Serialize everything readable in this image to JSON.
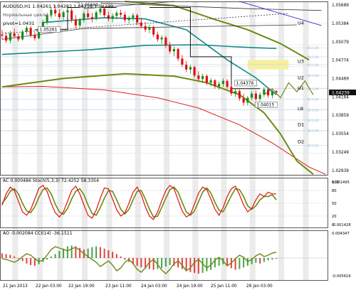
{
  "header": {
    "symbol_line": "AUDUSD,H1  1.04261 1.04282 1.04219 1.04239",
    "subtitle": "Нормальные циклы...",
    "pivot_line": "pivot=1.0431"
  },
  "colors": {
    "background": "#ffffff",
    "bull": "#1a8a1a",
    "bear": "#e01010",
    "teal_ma": "#118888",
    "olive_ma": "#6b8a10",
    "red_ma": "#e02020",
    "blue_line": "#4444dd",
    "pivot_zone": "#f5f0a0",
    "grid_band": "#e4e4e4"
  },
  "chart_data": [
    {
      "type": "candlestick",
      "panel": "price",
      "title": "AUDUSD,H1",
      "ohlc_last": {
        "open": 1.04261,
        "high": 1.04282,
        "low": 1.04219,
        "close": 1.04239
      },
      "ylim": [
        1.0287,
        1.0575
      ],
      "y_ticks": [
        "1.05689",
        "1.05384",
        "1.05079",
        "1.04774",
        "1.04469",
        "1.04164",
        "1.03859",
        "1.03554",
        "1.03249",
        "1.02939"
      ],
      "current_price_label": "1.04239",
      "candles": [
        [
          1.052,
          1.0528,
          1.0512,
          1.0518
        ],
        [
          1.0518,
          1.0524,
          1.0506,
          1.051
        ],
        [
          1.051,
          1.0526,
          1.0505,
          1.0522
        ],
        [
          1.0522,
          1.053,
          1.0515,
          1.0517
        ],
        [
          1.0517,
          1.0522,
          1.0508,
          1.0512
        ],
        [
          1.0512,
          1.0528,
          1.051,
          1.0525
        ],
        [
          1.0525,
          1.0535,
          1.052,
          1.0531
        ],
        [
          1.0531,
          1.0534,
          1.0515,
          1.0519
        ],
        [
          1.0519,
          1.0524,
          1.051,
          1.0514
        ],
        [
          1.0514,
          1.053,
          1.0512,
          1.0527
        ],
        [
          1.0527,
          1.0545,
          1.0525,
          1.0541
        ],
        [
          1.0541,
          1.0556,
          1.0536,
          1.0552
        ],
        [
          1.0552,
          1.0566,
          1.0547,
          1.0561
        ],
        [
          1.0561,
          1.0569,
          1.055,
          1.0555
        ],
        [
          1.0555,
          1.0562,
          1.0545,
          1.0549
        ],
        [
          1.0549,
          1.056,
          1.0544,
          1.0557
        ],
        [
          1.0557,
          1.0566,
          1.0552,
          1.056
        ],
        [
          1.056,
          1.0564,
          1.054,
          1.0545
        ],
        [
          1.0545,
          1.0552,
          1.053,
          1.0535
        ],
        [
          1.0535,
          1.0548,
          1.0531,
          1.0544
        ],
        [
          1.0544,
          1.0559,
          1.054,
          1.0555
        ],
        [
          1.0555,
          1.0562,
          1.0545,
          1.0549
        ],
        [
          1.0549,
          1.0556,
          1.054,
          1.0546
        ],
        [
          1.0546,
          1.056,
          1.0543,
          1.0557
        ],
        [
          1.0557,
          1.0567,
          1.0552,
          1.0563
        ],
        [
          1.0563,
          1.0566,
          1.0548,
          1.0552
        ],
        [
          1.0552,
          1.0558,
          1.0542,
          1.0546
        ],
        [
          1.0546,
          1.0555,
          1.054,
          1.0551
        ],
        [
          1.0551,
          1.056,
          1.0545,
          1.0556
        ],
        [
          1.0556,
          1.0561,
          1.0549,
          1.0553
        ],
        [
          1.0553,
          1.0558,
          1.054,
          1.0544
        ],
        [
          1.0544,
          1.0551,
          1.0538,
          1.0548
        ],
        [
          1.0548,
          1.0556,
          1.0542,
          1.0552
        ],
        [
          1.0552,
          1.0555,
          1.0536,
          1.054
        ],
        [
          1.054,
          1.0548,
          1.053,
          1.0534
        ],
        [
          1.0534,
          1.0541,
          1.0524,
          1.0528
        ],
        [
          1.0528,
          1.0536,
          1.0522,
          1.0532
        ],
        [
          1.0532,
          1.0535,
          1.0516,
          1.052
        ],
        [
          1.052,
          1.0525,
          1.0508,
          1.0512
        ],
        [
          1.0512,
          1.0519,
          1.0504,
          1.0515
        ],
        [
          1.0515,
          1.0518,
          1.0498,
          1.0502
        ],
        [
          1.0502,
          1.0508,
          1.0488,
          1.0492
        ],
        [
          1.0492,
          1.05,
          1.0484,
          1.0496
        ],
        [
          1.0496,
          1.0498,
          1.0476,
          1.048
        ],
        [
          1.048,
          1.0486,
          1.0466,
          1.047
        ],
        [
          1.047,
          1.0476,
          1.0458,
          1.0462
        ],
        [
          1.0462,
          1.047,
          1.0455,
          1.0466
        ],
        [
          1.0466,
          1.0468,
          1.0448,
          1.0452
        ],
        [
          1.0452,
          1.0459,
          1.0442,
          1.0446
        ],
        [
          1.0446,
          1.0455,
          1.044,
          1.0451
        ],
        [
          1.0451,
          1.0454,
          1.0436,
          1.044
        ],
        [
          1.044,
          1.0448,
          1.0434,
          1.0444
        ],
        [
          1.0444,
          1.0446,
          1.043,
          1.0434
        ],
        [
          1.0434,
          1.0442,
          1.0428,
          1.0438
        ],
        [
          1.0438,
          1.0447,
          1.0433,
          1.0443
        ],
        [
          1.0443,
          1.0446,
          1.043,
          1.0433
        ],
        [
          1.0433,
          1.0437,
          1.0418,
          1.0422
        ],
        [
          1.0422,
          1.043,
          1.0416,
          1.0426
        ],
        [
          1.0426,
          1.0429,
          1.041,
          1.0414
        ],
        [
          1.0414,
          1.0422,
          1.0402,
          1.0407
        ],
        [
          1.0407,
          1.0418,
          1.0402,
          1.0415
        ],
        [
          1.0415,
          1.0426,
          1.0411,
          1.0422
        ],
        [
          1.0422,
          1.0427,
          1.041,
          1.0413
        ],
        [
          1.0413,
          1.0424,
          1.0409,
          1.042
        ],
        [
          1.042,
          1.0433,
          1.0416,
          1.0429
        ],
        [
          1.0429,
          1.0431,
          1.0415,
          1.0419
        ],
        [
          1.0419,
          1.0428,
          1.0414,
          1.0426
        ],
        [
          1.0426,
          1.0428,
          1.0422,
          1.0424
        ]
      ],
      "price_labels": [
        "1.05669",
        "1.05261",
        "1.04376",
        "1.04015"
      ],
      "pivot_levels": [
        "U4",
        "U3",
        "U2",
        "U1",
        "LB",
        "D1",
        "D2"
      ],
      "pivot_values": [
        1.0539,
        1.0475,
        1.0448,
        1.0431,
        1.0397,
        1.037,
        1.0342
      ],
      "faint_labels": [
        "R5 1.05",
        "R4 1.04",
        "R3 1.04",
        "R2 1.04",
        "R1 1.04",
        "S1 1.04",
        "S2 1.03",
        "S3 1.03",
        "S4 1.03",
        "S5 1.03"
      ],
      "faint_values": [
        1.0498,
        1.0483,
        1.047,
        1.0452,
        1.043,
        1.0413,
        1.0395,
        1.0378,
        1.0361,
        1.0336
      ],
      "pivot_zone": [
        1.0462,
        1.0478
      ],
      "teal_ma": [
        [
          0,
          1.0487
        ],
        [
          22,
          1.0495
        ],
        [
          35,
          1.0502
        ],
        [
          48,
          1.0503
        ],
        [
          56,
          1.05
        ],
        [
          62,
          1.0498
        ],
        [
          67,
          1.0497
        ]
      ],
      "teal_ma2": [
        [
          10,
          1.054
        ],
        [
          25,
          1.0548
        ],
        [
          35,
          1.0546
        ],
        [
          45,
          1.0528
        ],
        [
          55,
          1.0478
        ],
        [
          62,
          1.0448
        ],
        [
          67,
          1.042
        ]
      ],
      "olive_ma": [
        [
          0,
          1.0433
        ],
        [
          15,
          1.0447
        ],
        [
          30,
          1.0455
        ],
        [
          42,
          1.0451
        ],
        [
          50,
          1.044
        ],
        [
          58,
          1.042
        ],
        [
          64,
          1.039
        ],
        [
          68,
          1.0355
        ],
        [
          72,
          1.031
        ],
        [
          76,
          1.0288
        ]
      ],
      "olive_ma2": [
        [
          30,
          1.0575
        ],
        [
          42,
          1.0568
        ],
        [
          52,
          1.0545
        ],
        [
          60,
          1.0528
        ],
        [
          68,
          1.0505
        ],
        [
          75,
          1.0478
        ]
      ],
      "red_ma": [
        [
          0,
          1.0433
        ],
        [
          10,
          1.0434
        ],
        [
          25,
          1.0428
        ],
        [
          38,
          1.0415
        ],
        [
          48,
          1.0398
        ],
        [
          58,
          1.037
        ],
        [
          66,
          1.034
        ],
        [
          75,
          1.03
        ],
        [
          79,
          1.0288
        ]
      ],
      "projection": [
        [
          64,
          1.042
        ],
        [
          66,
          1.043
        ],
        [
          68,
          1.0415
        ],
        [
          70,
          1.044
        ],
        [
          72,
          1.0425
        ],
        [
          74,
          1.0443
        ],
        [
          76,
          1.042
        ]
      ],
      "dark_lines": [
        [
          [
            0,
            1.0522
          ],
          [
            70,
            1.0555
          ]
        ],
        [
          [
            0,
            1.0512
          ],
          [
            20,
            1.053
          ],
          [
            72,
            1.0536
          ]
        ],
        [
          [
            20,
            1.0563
          ],
          [
            42,
            1.0575
          ]
        ],
        [
          [
            14,
            1.0575
          ],
          [
            60,
            1.0563
          ],
          [
            78,
            1.056
          ]
        ]
      ],
      "blue_line": [
        [
          58,
          1.0575
        ],
        [
          78,
          1.0535
        ]
      ],
      "boxes": [
        [
          [
            8,
            1.0528
          ],
          [
            16,
            1.0528
          ],
          [
            16,
            1.0565
          ],
          [
            28,
            1.0565
          ]
        ],
        [
          [
            36,
            1.0565
          ],
          [
            46,
            1.0565
          ],
          [
            46,
            1.0483
          ],
          [
            56,
            1.0483
          ],
          [
            56,
            1.043
          ],
          [
            63,
            1.043
          ]
        ]
      ],
      "vertical_bands": [
        3,
        9,
        14,
        20,
        26,
        33,
        40,
        47,
        54,
        61,
        68,
        74
      ]
    },
    {
      "type": "line",
      "panel": "ac_stoch",
      "header": "AC 0.000486  Stoch(5,3,3) 72.4252 58.3354",
      "right_labels": [
        "0.001495",
        "100",
        "80",
        "50",
        "20",
        "0",
        "-0.001428"
      ],
      "stoch_main": [
        45,
        72,
        88,
        80,
        55,
        30,
        22,
        35,
        60,
        85,
        92,
        78,
        50,
        28,
        18,
        30,
        55,
        80,
        90,
        72,
        46,
        22,
        15,
        34,
        62,
        86,
        84,
        60,
        35,
        20,
        28,
        50,
        76,
        88,
        70,
        42,
        20,
        12,
        30,
        56,
        80,
        92,
        84,
        58,
        32,
        18,
        24,
        48,
        74,
        88,
        82,
        60,
        36,
        22,
        40,
        66,
        84,
        90,
        70,
        46,
        30,
        38,
        58,
        72,
        66,
        76,
        72,
        72
      ],
      "stoch_signal": [
        50,
        62,
        78,
        84,
        72,
        50,
        32,
        28,
        42,
        64,
        82,
        86,
        72,
        48,
        30,
        24,
        38,
        60,
        78,
        84,
        70,
        46,
        26,
        22,
        40,
        62,
        80,
        78,
        58,
        36,
        25,
        36,
        58,
        78,
        80,
        60,
        36,
        18,
        20,
        40,
        62,
        82,
        88,
        76,
        52,
        30,
        22,
        32,
        54,
        76,
        86,
        74,
        52,
        34,
        30,
        48,
        68,
        84,
        82,
        66,
        44,
        36,
        44,
        58,
        66,
        66,
        70,
        58
      ]
    },
    {
      "type": "bar",
      "panel": "ao_cci",
      "header": "AO -0.002084  CCI(14) -36.1511",
      "right_labels": [
        "0.004347",
        "-0.005616"
      ],
      "ao": [
        12,
        10,
        8,
        4,
        -2,
        -8,
        -14,
        -18,
        -20,
        -16,
        -10,
        -4,
        4,
        10,
        18,
        24,
        30,
        32,
        30,
        26,
        22,
        24,
        28,
        30,
        28,
        24,
        20,
        16,
        10,
        4,
        -4,
        -10,
        -16,
        -20,
        -24,
        -26,
        -28,
        -30,
        -28,
        -26,
        -22,
        -18,
        -20,
        -24,
        -28,
        -32,
        -36,
        -38,
        -40,
        -38,
        -34,
        -30,
        -24,
        -20,
        -16,
        -20,
        -26,
        -30,
        -28,
        -24,
        -20,
        -16,
        -12,
        -14,
        -10,
        -6,
        -4,
        -2
      ],
      "cci": [
        -10,
        -20,
        -40,
        -60,
        -30,
        20,
        60,
        40,
        -10,
        -50,
        -30,
        40,
        120,
        160,
        140,
        120,
        100,
        130,
        150,
        110,
        60,
        20,
        -20,
        -60,
        -120,
        -80,
        -40,
        -100,
        -180,
        -140,
        -60,
        -20,
        -80,
        -160,
        -200,
        -140,
        -60,
        -20,
        -90,
        -170,
        -220,
        -160,
        -80,
        -40,
        -100,
        -180,
        -140,
        -60,
        -20,
        -80,
        -140,
        -100,
        -30,
        10,
        -40,
        -110,
        -70,
        -10,
        40,
        10,
        -50,
        -20,
        30,
        60,
        20,
        40,
        70,
        80
      ]
    },
    {
      "type": "axis",
      "panel": "time",
      "x_tick_labels": [
        "21 Jan 2013",
        "22 Jan 03:00",
        "22 Jan 19:00",
        "23 Jan 11:00",
        "24 Jan 03:00",
        "24 Jan 19:00",
        "25 Jan 11:00",
        "28 Jan 03:00"
      ]
    }
  ]
}
